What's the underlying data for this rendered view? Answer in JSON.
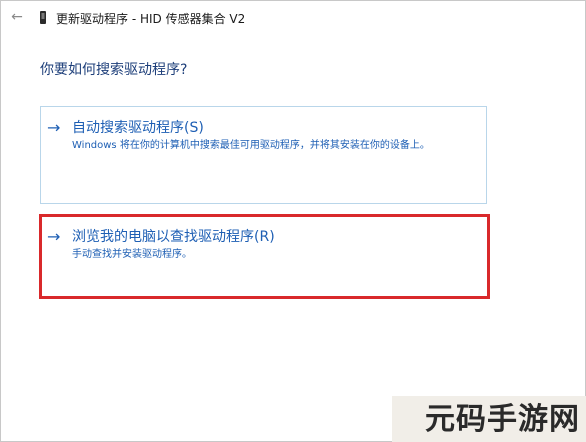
{
  "window": {
    "title": "更新驱动程序 - HID 传感器集合 V2",
    "back_icon": "arrow-left-icon",
    "device_icon": "device-icon"
  },
  "main": {
    "question": "你要如何搜索驱动程序?",
    "options": [
      {
        "arrow": "→",
        "title": "自动搜索驱动程序(S)",
        "description": "Windows 将在你的计算机中搜索最佳可用驱动程序，并将其安装在你的设备上。",
        "highlighted": false
      },
      {
        "arrow": "→",
        "title": "浏览我的电脑以查找驱动程序(R)",
        "description": "手动查找并安装驱动程序。",
        "highlighted": true
      }
    ]
  },
  "watermark": {
    "text": "元码手游网"
  },
  "colors": {
    "link_blue": "#1e5fb4",
    "heading_blue": "#1e3f7a",
    "option_border": "#b9d6ea",
    "highlight_red": "#d9292b"
  }
}
